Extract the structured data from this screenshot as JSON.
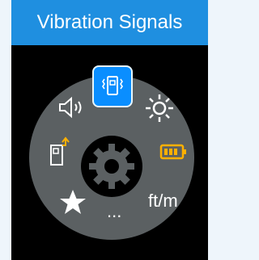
{
  "header": {
    "title": "Vibration Signals"
  },
  "menu": {
    "selected": "vibration",
    "items": [
      {
        "id": "vibration",
        "icon": "vibration-icon"
      },
      {
        "id": "brightness",
        "icon": "brightness-icon"
      },
      {
        "id": "battery",
        "icon": "battery-icon"
      },
      {
        "id": "units",
        "label": "ft/m"
      },
      {
        "id": "more",
        "label": "..."
      },
      {
        "id": "favorites",
        "icon": "star-icon"
      },
      {
        "id": "export",
        "icon": "export-icon"
      },
      {
        "id": "volume",
        "icon": "speaker-icon"
      }
    ],
    "center_icon": "gear-icon"
  }
}
